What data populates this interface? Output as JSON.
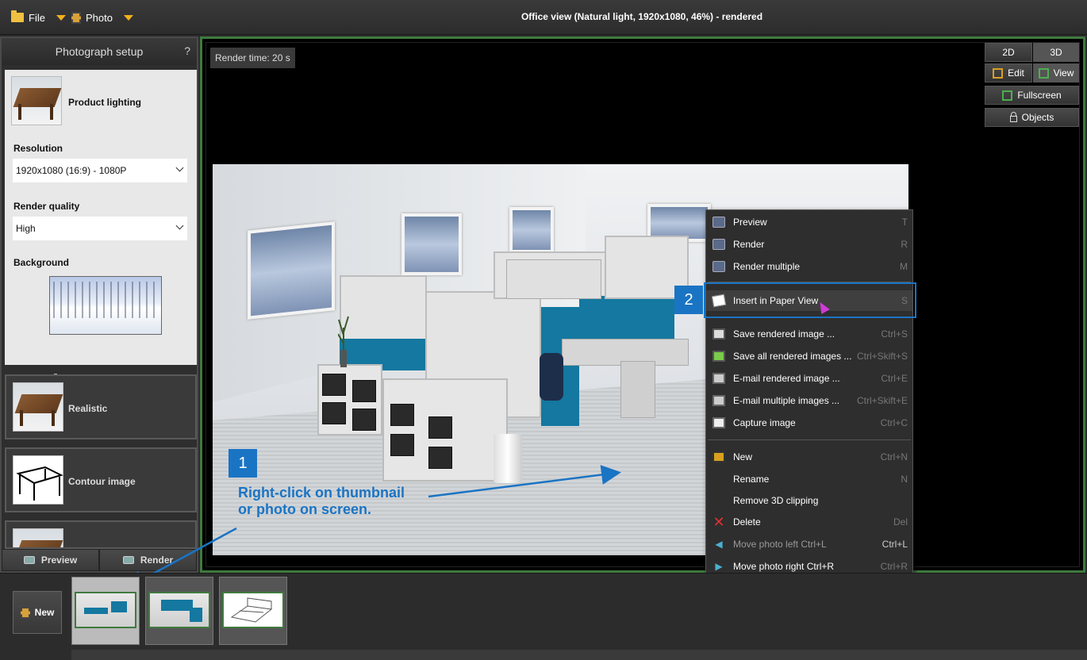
{
  "topbar": {
    "file_label": "File",
    "photo_label": "Photo",
    "window_title": "Office view (Natural light, 1920x1080, 46%) - rendered"
  },
  "left_panel": {
    "title": "Photograph setup",
    "help": "?",
    "active_preset": "Product lighting",
    "resolution_label": "Resolution",
    "resolution_value": "1920x1080 (16:9) - 1080P",
    "quality_label": "Render quality",
    "quality_value": "High",
    "background_label": "Background",
    "presets": [
      "Realistic",
      "Contour image"
    ],
    "preview_button": "Preview",
    "render_button": "Render"
  },
  "viewport": {
    "render_time": "Render time: 20 s",
    "btn_2d": "2D",
    "btn_3d": "3D",
    "btn_edit": "Edit",
    "btn_view": "View",
    "btn_fullscreen": "Fullscreen",
    "btn_objects": "Objects"
  },
  "context_menu": {
    "items": [
      {
        "label": "Preview",
        "shortcut": "T",
        "icon": "camera-icon"
      },
      {
        "label": "Render",
        "shortcut": "R",
        "icon": "camera-icon"
      },
      {
        "label": "Render multiple",
        "shortcut": "M",
        "icon": "camera-icon"
      },
      {
        "label": "Insert in Paper View",
        "shortcut": "S",
        "icon": "paper-view-icon"
      },
      {
        "label": "Save rendered image ...",
        "shortcut": "Ctrl+S",
        "icon": "save-icon"
      },
      {
        "label": "Save all rendered images ...",
        "shortcut": "Ctrl+Skift+S",
        "icon": "save-all-icon"
      },
      {
        "label": "E-mail rendered image ...",
        "shortcut": "Ctrl+E",
        "icon": "email-icon"
      },
      {
        "label": "E-mail multiple images ...",
        "shortcut": "Ctrl+Skift+E",
        "icon": "email-icon"
      },
      {
        "label": "Capture image",
        "shortcut": "Ctrl+C",
        "icon": "capture-icon"
      },
      {
        "label": "New",
        "shortcut": "Ctrl+N",
        "icon": "new-icon"
      },
      {
        "label": "Rename",
        "shortcut": "N",
        "icon": ""
      },
      {
        "label": "Remove 3D clipping",
        "shortcut": "",
        "icon": ""
      },
      {
        "label": "Delete",
        "shortcut": "Del",
        "icon": "delete-icon"
      },
      {
        "label": "Move photo left Ctrl+L",
        "shortcut": "Ctrl+L",
        "icon": "arrow-left-icon",
        "disabled": true
      },
      {
        "label": "Move photo right Ctrl+R",
        "shortcut": "Ctrl+R",
        "icon": "arrow-right-icon"
      }
    ]
  },
  "annotations": {
    "step1": "1",
    "step2": "2",
    "note_line1": "Right-click on thumbnail",
    "note_line2": "or photo on screen."
  },
  "strip": {
    "new_button": "New"
  },
  "colors": {
    "accent_blue": "#1a74c4",
    "frame_green": "#3f7a3f",
    "menu_orange": "#f2b01e"
  }
}
